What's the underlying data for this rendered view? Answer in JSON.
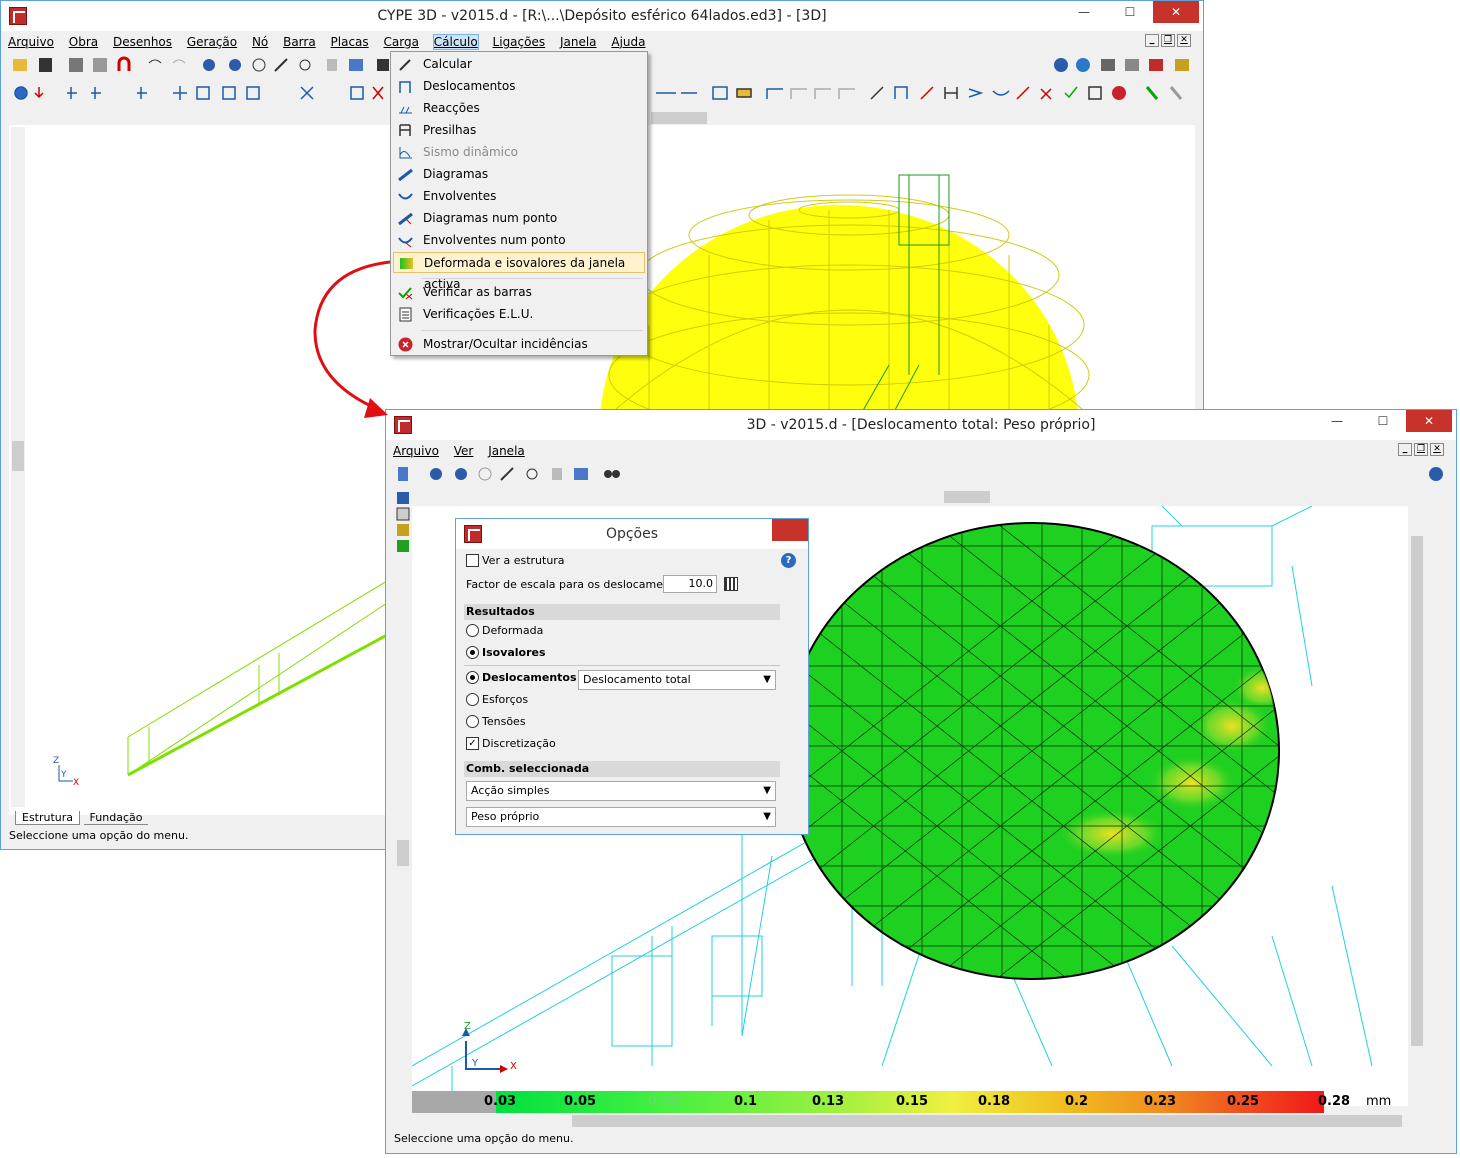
{
  "main_window": {
    "title": "CYPE 3D - v2015.d - [R:\\...\\Depósito esférico 64lados.ed3] - [3D]",
    "menus": [
      "Arquivo",
      "Obra",
      "Desenhos",
      "Geração",
      "Nó",
      "Barra",
      "Placas",
      "Carga",
      "Cálculo",
      "Ligações",
      "Janela",
      "Ajuda"
    ],
    "tabs": [
      "Estrutura",
      "Fundação"
    ],
    "status": "Seleccione uma opção do menu."
  },
  "calc_menu": {
    "items": [
      {
        "label": "Calcular",
        "icon": "calculate-icon",
        "disabled": false
      },
      {
        "label": "Deslocamentos",
        "icon": "displacements-icon",
        "disabled": false
      },
      {
        "label": "Reacções",
        "icon": "reactions-icon",
        "disabled": false
      },
      {
        "label": "Presilhas",
        "icon": "clamps-icon",
        "disabled": false
      },
      {
        "label": "Sismo dinâmico",
        "icon": "seismic-icon",
        "disabled": true
      },
      {
        "label": "Diagramas",
        "icon": "diagrams-icon",
        "disabled": false
      },
      {
        "label": "Envolventes",
        "icon": "envelopes-icon",
        "disabled": false
      },
      {
        "label": "Diagramas num ponto",
        "icon": "point-diagrams-icon",
        "disabled": false
      },
      {
        "label": "Envolventes num ponto",
        "icon": "point-envelopes-icon",
        "disabled": false
      },
      {
        "label": "Deformada e isovalores da janela activa",
        "icon": "isovalues-icon",
        "disabled": false,
        "highlighted": true
      },
      {
        "label": "Verificar as barras",
        "icon": "check-bars-icon",
        "disabled": false
      },
      {
        "label": "Verificações E.L.U.",
        "icon": "elu-checks-icon",
        "disabled": false
      },
      {
        "label": "Mostrar/Ocultar incidências",
        "icon": "incidences-icon",
        "disabled": false
      }
    ]
  },
  "result_window": {
    "title": "3D - v2015.d - [Deslocamento total: Peso próprio]",
    "menus": [
      "Arquivo",
      "Ver",
      "Janela"
    ],
    "status": "Seleccione uma opção do menu."
  },
  "options_dialog": {
    "title": "Opções",
    "see_structure": "Ver a estrutura",
    "scale_label": "Factor de escala para os deslocamentos",
    "scale_value": "10.0",
    "results_header": "Resultados",
    "deformed": "Deformada",
    "isovalues": "Isovalores",
    "displacements": "Deslocamentos",
    "displacement_type": "Deslocamento total",
    "forces": "Esforços",
    "stresses": "Tensões",
    "discretization": "Discretização",
    "combination_header": "Comb. seleccionada",
    "action": "Acção simples",
    "load_case": "Peso próprio"
  },
  "legend": {
    "unit": "mm",
    "labels": [
      "0.03",
      "0.05",
      "0.08",
      "0.1",
      "0.13",
      "0.15",
      "0.18",
      "0.2",
      "0.23",
      "0.25",
      "0.28"
    ],
    "colors": [
      "#00e040",
      "#22ee44",
      "#44f040",
      "#66f040",
      "#99f040",
      "#ccf040",
      "#f0f040",
      "#f0c020",
      "#f09020",
      "#f05020",
      "#f01818"
    ]
  },
  "axes": {
    "z": "Z",
    "y": "Y",
    "x": "X"
  }
}
